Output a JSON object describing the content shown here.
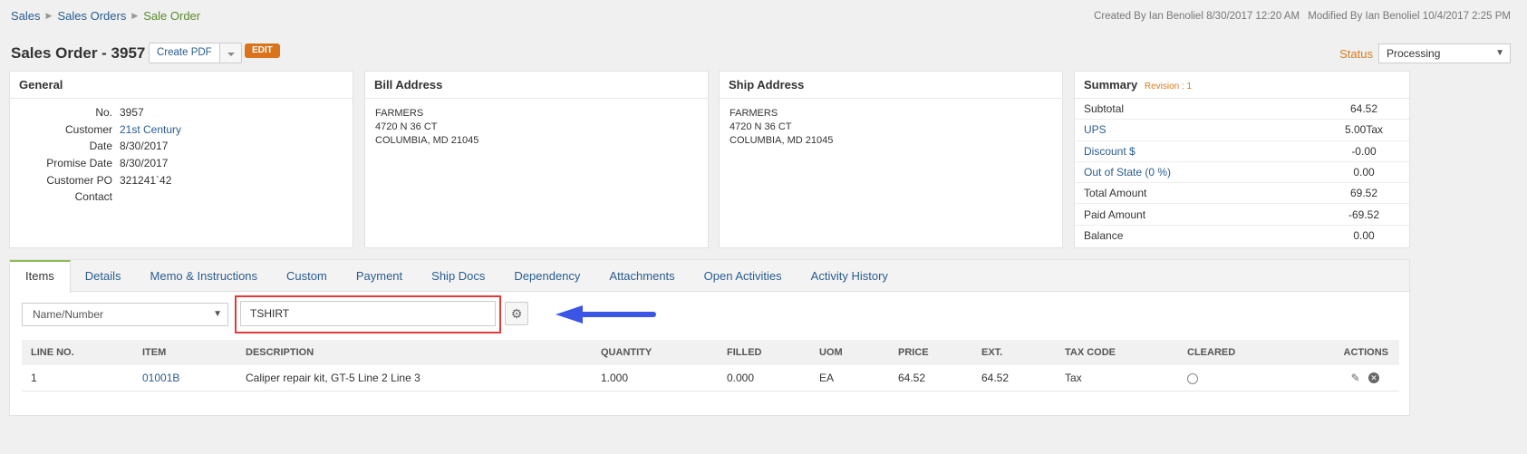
{
  "breadcrumb": [
    "Sales",
    "Sales Orders",
    "Sale Order"
  ],
  "meta": {
    "created": "Created By Ian Benoliel 8/30/2017 12:20 AM",
    "modified": "Modified By Ian Benoliel 10/4/2017 2:25 PM"
  },
  "header": {
    "title": "Sales Order - 3957",
    "create_pdf": "Create PDF",
    "edit": "EDIT",
    "status_label": "Status",
    "status_value": "Processing"
  },
  "general": {
    "title": "General",
    "fields": [
      {
        "label": "No.",
        "value": "3957"
      },
      {
        "label": "Customer",
        "value": "21st Century"
      },
      {
        "label": "Date",
        "value": "8/30/2017"
      },
      {
        "label": "Promise Date",
        "value": "8/30/2017"
      },
      {
        "label": "Customer PO",
        "value": "321241`42"
      },
      {
        "label": "Contact",
        "value": ""
      }
    ]
  },
  "bill_address": {
    "title": "Bill Address",
    "lines": [
      "FARMERS",
      "4720 N 36 CT",
      "COLUMBIA, MD 21045"
    ]
  },
  "ship_address": {
    "title": "Ship Address",
    "lines": [
      "FARMERS",
      "4720 N 36 CT",
      "COLUMBIA, MD 21045"
    ]
  },
  "summary": {
    "title": "Summary",
    "revision": "Revision : 1",
    "rows": [
      {
        "label": "Subtotal",
        "value": "64.52"
      },
      {
        "label": "UPS",
        "value": "5.00Tax"
      },
      {
        "label": "Discount $",
        "value": "-0.00"
      },
      {
        "label": "Out of State (0 %)",
        "value": "0.00"
      },
      {
        "label": "Total Amount",
        "value": "69.52"
      },
      {
        "label": "Paid Amount",
        "value": "-69.52"
      },
      {
        "label": "Balance",
        "value": "0.00"
      }
    ]
  },
  "tabs": [
    "Items",
    "Details",
    "Memo & Instructions",
    "Custom",
    "Payment",
    "Ship Docs",
    "Dependency",
    "Attachments",
    "Open Activities",
    "Activity History"
  ],
  "filter": {
    "select_value": "Name/Number",
    "search_value": "TSHIRT"
  },
  "table": {
    "headers": [
      "LINE NO.",
      "ITEM",
      "DESCRIPTION",
      "QUANTITY",
      "FILLED",
      "UOM",
      "PRICE",
      "EXT.",
      "TAX CODE",
      "CLEARED",
      "ACTIONS"
    ],
    "rows": [
      {
        "line": "1",
        "item": "01001B",
        "description": "Caliper repair kit, GT-5 Line 2 Line 3",
        "quantity": "1.000",
        "filled": "0.000",
        "uom": "EA",
        "price": "64.52",
        "ext": "64.52",
        "tax": "Tax"
      }
    ]
  },
  "colors": {
    "link": "#2a5d8f",
    "accent_orange": "#d97b1c",
    "highlight_red": "#e23b3b",
    "arrow_blue": "#3b55e6"
  }
}
